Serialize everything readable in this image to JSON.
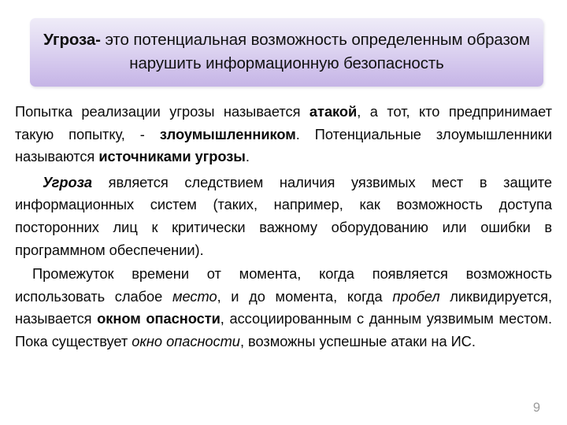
{
  "slide": {
    "page_number": "9",
    "accent_color": "#c5b4e6",
    "banner_gradient_top": "#efecf8",
    "banner_gradient_bottom": "#c5b4e6",
    "text_color": "#0a0a0a",
    "page_number_color": "#9b9b9b"
  },
  "title": {
    "keyword": "Угроза-",
    "rest": " это потенциальная возможность определенным образом нарушить информационную безопасность",
    "full": "Угроза- это потенциальная возможность определенным образом нарушить информационную безопасность"
  },
  "body": {
    "paragraph1": {
      "seg1": "Попытка реализации угрозы называется ",
      "bold1": "атакой",
      "seg2": ", а тот, кто предпринимает такую попытку, - ",
      "bold2": "злоумышленником",
      "seg3": ". Потенциальные злоумышленники называются ",
      "bold3": "источниками угрозы",
      "seg4": "."
    },
    "paragraph2": {
      "bolditalic1": "Угроза",
      "seg1": " является следствием наличия уязвимых мест в защите информационных систем (таких, например, как возможность доступа посторонних лиц к критически важному оборудованию или ошибки в программном обеспечении)."
    },
    "paragraph3": {
      "seg1": "Промежуток времени от момента, когда появляется возможность использовать слабое ",
      "italic1": "место",
      "seg2": ", и до момента, когда ",
      "italic2": "пробел",
      "seg3": " ликвидируется, называется ",
      "bold1": "окном опасности",
      "seg4": ", ассоциированным с данным уязвимым местом. Пока существует ",
      "italic3": "окно опасности",
      "seg5": ", возможны успешные атаки на ИС."
    }
  }
}
